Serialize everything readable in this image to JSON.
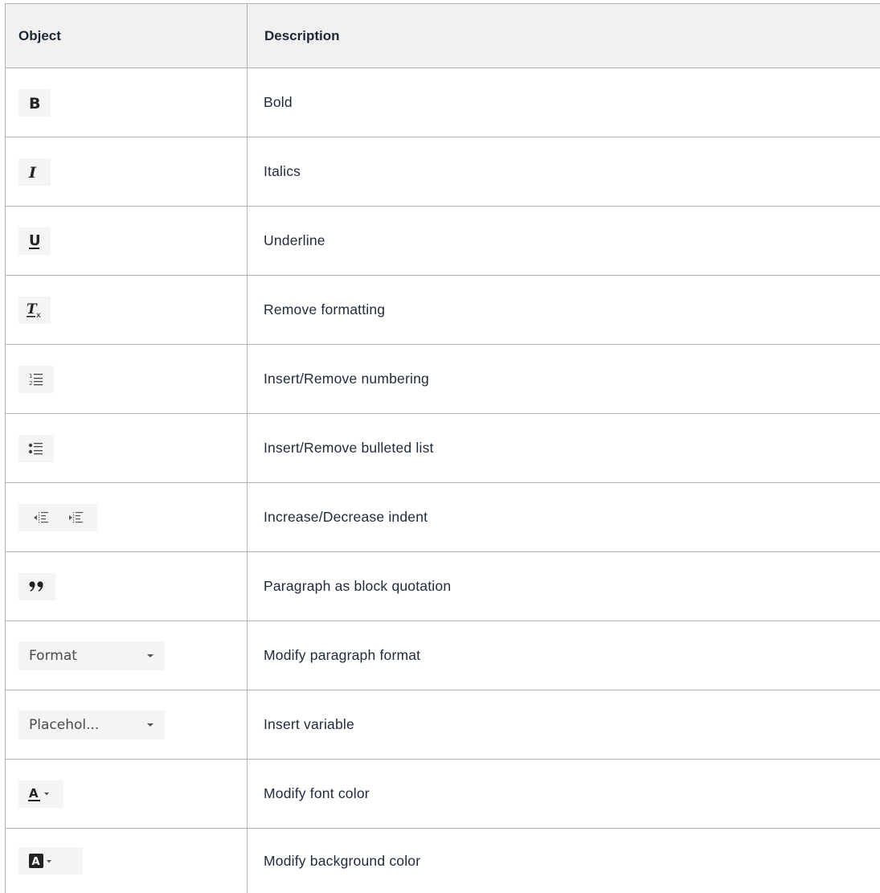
{
  "table": {
    "headers": {
      "object": "Object",
      "description": "Description"
    },
    "rows": [
      {
        "icon": "bold-icon",
        "description": "Bold"
      },
      {
        "icon": "italic-icon",
        "description": "Italics"
      },
      {
        "icon": "underline-icon",
        "description": "Underline"
      },
      {
        "icon": "remove-format-icon",
        "description": "Remove formatting"
      },
      {
        "icon": "numbered-list-icon",
        "description": "Insert/Remove numbering"
      },
      {
        "icon": "bulleted-list-icon",
        "description": "Insert/Remove bulleted list"
      },
      {
        "icon": "indent-outdent-icons",
        "description": "Increase/Decrease indent"
      },
      {
        "icon": "block-quote-icon",
        "description": "Paragraph as block quotation"
      },
      {
        "icon": "format-dropdown",
        "control_label": "Format",
        "description": "Modify paragraph format"
      },
      {
        "icon": "placeholder-dropdown",
        "control_label": "Placehol...",
        "description": "Insert variable"
      },
      {
        "icon": "font-color-icon",
        "description": "Modify font color"
      },
      {
        "icon": "background-color-icon",
        "description": "Modify background color"
      }
    ]
  }
}
